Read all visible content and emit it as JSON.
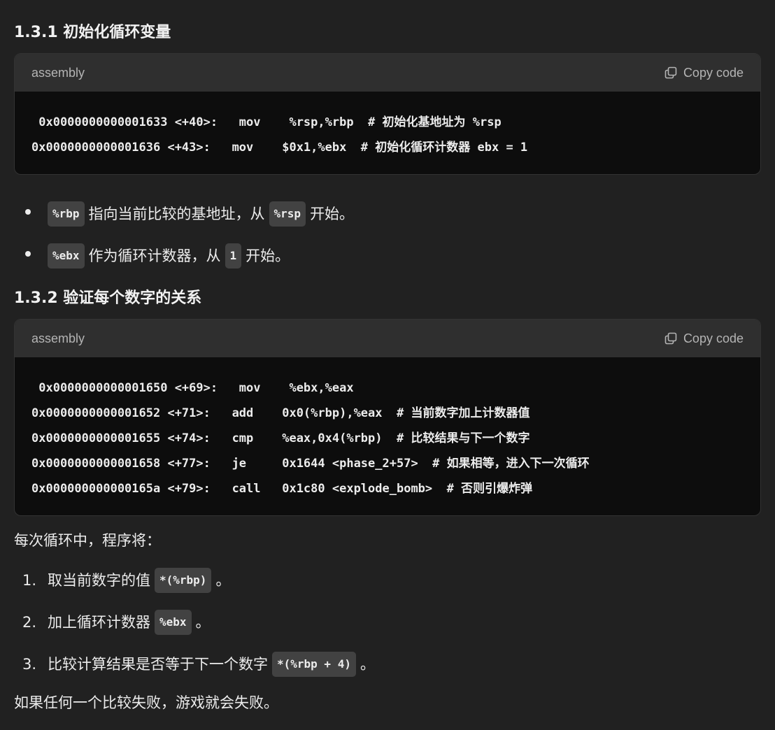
{
  "section1": {
    "heading": "1.3.1 初始化循环变量",
    "code": {
      "lang": "assembly",
      "copy_label": "Copy code",
      "lines": [
        " 0x0000000000001633 <+40>:   mov    %rsp,%rbp  # 初始化基地址为 %rsp",
        "0x0000000000001636 <+43>:   mov    $0x1,%ebx  # 初始化循环计数器 ebx = 1"
      ]
    },
    "bullets": [
      {
        "code1": "%rbp",
        "text1": "指向当前比较的基地址，从",
        "code2": "%rsp",
        "text2": "开始。"
      },
      {
        "code1": "%ebx",
        "text1": "作为循环计数器，从",
        "code2": "1",
        "text2": "开始。"
      }
    ]
  },
  "section2": {
    "heading": "1.3.2 验证每个数字的关系",
    "code": {
      "lang": "assembly",
      "copy_label": "Copy code",
      "lines": [
        " 0x0000000000001650 <+69>:   mov    %ebx,%eax",
        "0x0000000000001652 <+71>:   add    0x0(%rbp),%eax  # 当前数字加上计数器值",
        "0x0000000000001655 <+74>:   cmp    %eax,0x4(%rbp)  # 比较结果与下一个数字",
        "0x0000000000001658 <+77>:   je     0x1644 <phase_2+57>  # 如果相等，进入下一次循环",
        "0x000000000000165a <+79>:   call   0x1c80 <explode_bomb>  # 否则引爆炸弹"
      ]
    },
    "intro": "每次循环中，程序将：",
    "steps": [
      {
        "num": "1.",
        "text": "取当前数字的值",
        "code": "*(%rbp)",
        "end": "。"
      },
      {
        "num": "2.",
        "text": "加上循环计数器",
        "code": "%ebx",
        "end": "。"
      },
      {
        "num": "3.",
        "text": "比较计算结果是否等于下一个数字",
        "code": "*(%rbp + 4)",
        "end": "。"
      }
    ],
    "conclusion": "如果任何一个比较失败，游戏就会失败。"
  }
}
